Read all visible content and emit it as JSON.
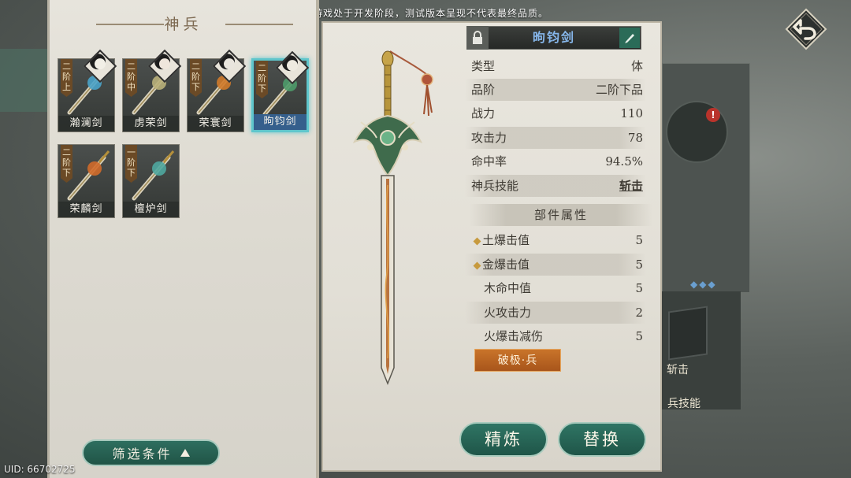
{
  "notice": "本游戏处于开发阶段，测试版本呈现不代表最终品质。",
  "uid": "UID: 66702725",
  "left_panel": {
    "title": "神兵",
    "weapons": [
      {
        "name": "瀚澜剑",
        "tier": "二阶上",
        "selected": false,
        "accent": "#4aa3c9"
      },
      {
        "name": "虏荣剑",
        "tier": "二阶中",
        "selected": false,
        "accent": "#b9b07a"
      },
      {
        "name": "荣寰剑",
        "tier": "二阶下",
        "selected": false,
        "accent": "#d07a2a"
      },
      {
        "name": "昫钧剑",
        "tier": "二阶下",
        "selected": true,
        "accent": "#4e9a6a"
      },
      {
        "name": "荣麟剑",
        "tier": "二阶下",
        "selected": false,
        "accent": "#d06a2a"
      },
      {
        "name": "檀炉剑",
        "tier": "一阶下",
        "selected": false,
        "accent": "#4fa7a0"
      }
    ],
    "filter_label": "筛选条件"
  },
  "detail": {
    "weapon_name": "昫钧剑",
    "stats": [
      {
        "label": "类型",
        "value": "体"
      },
      {
        "label": "品阶",
        "value": "二阶下品"
      },
      {
        "label": "战力",
        "value": "110"
      },
      {
        "label": "攻击力",
        "value": "78"
      },
      {
        "label": "命中率",
        "value": "94.5%"
      },
      {
        "label": "神兵技能",
        "value": "斩击"
      }
    ],
    "parts_header": "部件属性",
    "parts": [
      {
        "label": "土爆击值",
        "value": "5",
        "marked": true
      },
      {
        "label": "金爆击值",
        "value": "5",
        "marked": true
      },
      {
        "label": "木命中值",
        "value": "5",
        "marked": false
      },
      {
        "label": "火攻击力",
        "value": "2",
        "marked": false
      },
      {
        "label": "火爆击减伤",
        "value": "5",
        "marked": false
      }
    ],
    "break_label": "破极·兵",
    "refine_label": "精炼",
    "replace_label": "替换"
  },
  "background": {
    "badge": "!",
    "skill_text": "斩击",
    "skill_caption": "兵技能"
  },
  "colors": {
    "accent_teal": "#5fc6cc",
    "button_green": "#2f7564",
    "name_blue": "#86b6ea",
    "break_orange": "#c9742a"
  }
}
